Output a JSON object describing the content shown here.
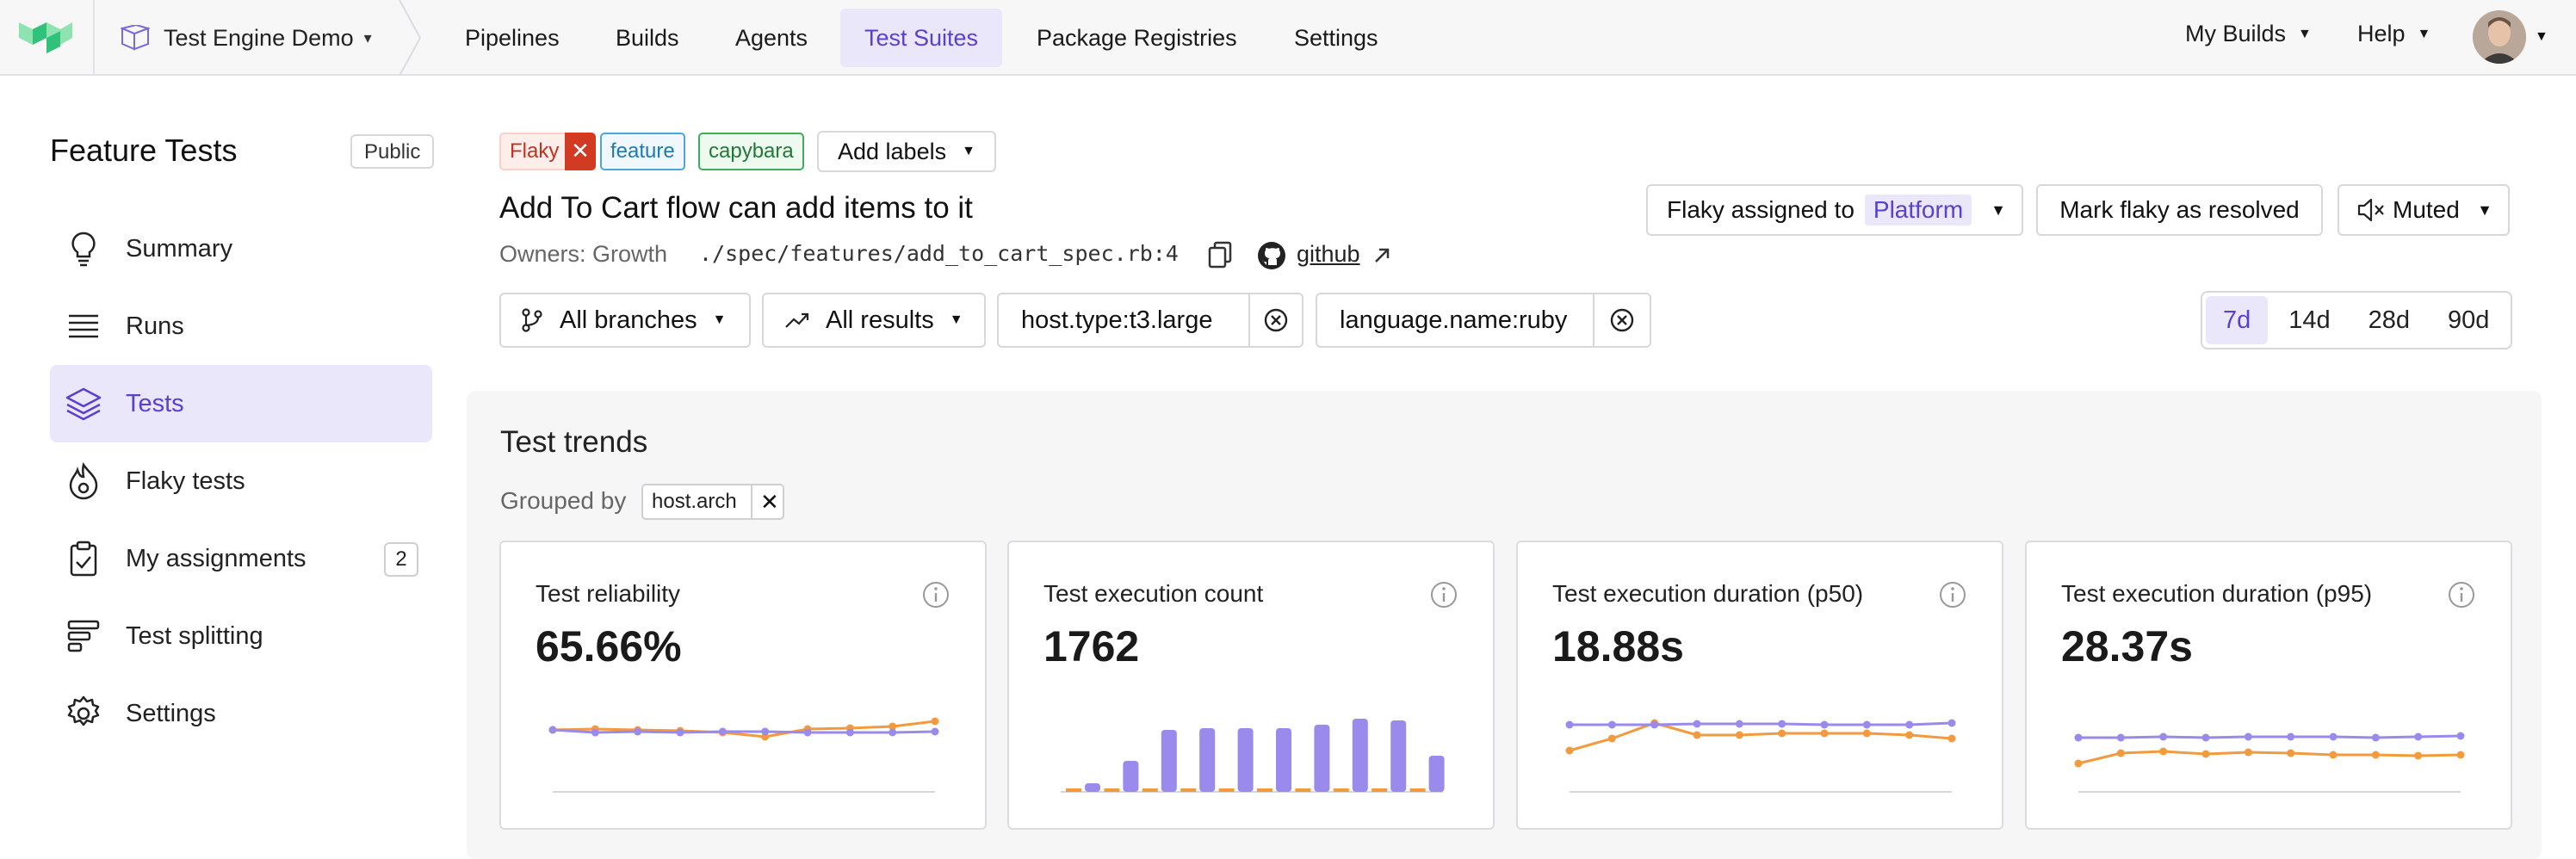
{
  "topnav": {
    "org_name": "Test Engine Demo",
    "items": [
      {
        "label": "Pipelines",
        "active": false
      },
      {
        "label": "Builds",
        "active": false
      },
      {
        "label": "Agents",
        "active": false
      },
      {
        "label": "Test Suites",
        "active": true
      },
      {
        "label": "Package Registries",
        "active": false
      },
      {
        "label": "Settings",
        "active": false
      }
    ],
    "my_builds": "My Builds",
    "help": "Help"
  },
  "sidebar": {
    "title": "Feature Tests",
    "visibility": "Public",
    "items": [
      {
        "label": "Summary",
        "icon": "lightbulb-icon",
        "active": false
      },
      {
        "label": "Runs",
        "icon": "list-icon",
        "active": false
      },
      {
        "label": "Tests",
        "icon": "layers-icon",
        "active": true
      },
      {
        "label": "Flaky tests",
        "icon": "flame-icon",
        "active": false
      },
      {
        "label": "My assignments",
        "icon": "clipboard-check-icon",
        "active": false,
        "count": "2"
      },
      {
        "label": "Test splitting",
        "icon": "split-bars-icon",
        "active": false
      },
      {
        "label": "Settings",
        "icon": "gear-icon",
        "active": false
      }
    ]
  },
  "test": {
    "labels": {
      "flaky": "Flaky",
      "feature": "feature",
      "capybara": "capybara",
      "add_labels": "Add labels"
    },
    "title": "Add To Cart flow can add items to it",
    "owners": "Owners: Growth",
    "path": "./spec/features/add_to_cart_spec.rb:4",
    "source_link": "github",
    "flaky_assigned_label": "Flaky assigned to",
    "flaky_assignee": "Platform",
    "mark_resolved": "Mark flaky as resolved",
    "muted": "Muted"
  },
  "filters": {
    "branches": "All branches",
    "results": "All results",
    "host_type": "host.type:t3.large",
    "language": "language.name:ruby"
  },
  "ranges": [
    {
      "label": "7d",
      "active": true
    },
    {
      "label": "14d",
      "active": false
    },
    {
      "label": "28d",
      "active": false
    },
    {
      "label": "90d",
      "active": false
    }
  ],
  "trends": {
    "title": "Test trends",
    "grouped_by_label": "Grouped by",
    "group_key": "host.arch",
    "colors": {
      "series_a": "#9a8aec",
      "series_b": "#f29a3e",
      "baseline": "#d8d8dc"
    },
    "cards": [
      {
        "title": "Test reliability",
        "value": "65.66%",
        "chart_type": "line",
        "series_a": [
          0.72,
          0.69,
          0.7,
          0.69,
          0.7,
          0.7,
          0.69,
          0.69,
          0.69,
          0.7
        ],
        "series_b": [
          0.72,
          0.73,
          0.72,
          0.71,
          0.69,
          0.64,
          0.73,
          0.74,
          0.76,
          0.82
        ]
      },
      {
        "title": "Test execution count",
        "value": "1762",
        "chart_type": "bar",
        "series_a": [
          0.1,
          0.36,
          0.72,
          0.74,
          0.74,
          0.74,
          0.78,
          0.85,
          0.83,
          0.42
        ],
        "series_b": [
          0.04,
          0.04,
          0.04,
          0.04,
          0.04,
          0.04,
          0.04,
          0.04,
          0.04,
          0.04
        ]
      },
      {
        "title": "Test execution duration (p50)",
        "value": "18.88s",
        "chart_type": "line",
        "series_a": [
          0.78,
          0.78,
          0.78,
          0.79,
          0.79,
          0.79,
          0.78,
          0.78,
          0.78,
          0.8
        ],
        "series_b": [
          0.48,
          0.62,
          0.8,
          0.66,
          0.66,
          0.68,
          0.68,
          0.68,
          0.66,
          0.62
        ]
      },
      {
        "title": "Test execution duration (p95)",
        "value": "28.37s",
        "chart_type": "line",
        "series_a": [
          0.63,
          0.63,
          0.64,
          0.63,
          0.64,
          0.64,
          0.64,
          0.63,
          0.64,
          0.65
        ],
        "series_b": [
          0.33,
          0.45,
          0.47,
          0.44,
          0.46,
          0.45,
          0.43,
          0.43,
          0.42,
          0.43
        ]
      }
    ]
  }
}
